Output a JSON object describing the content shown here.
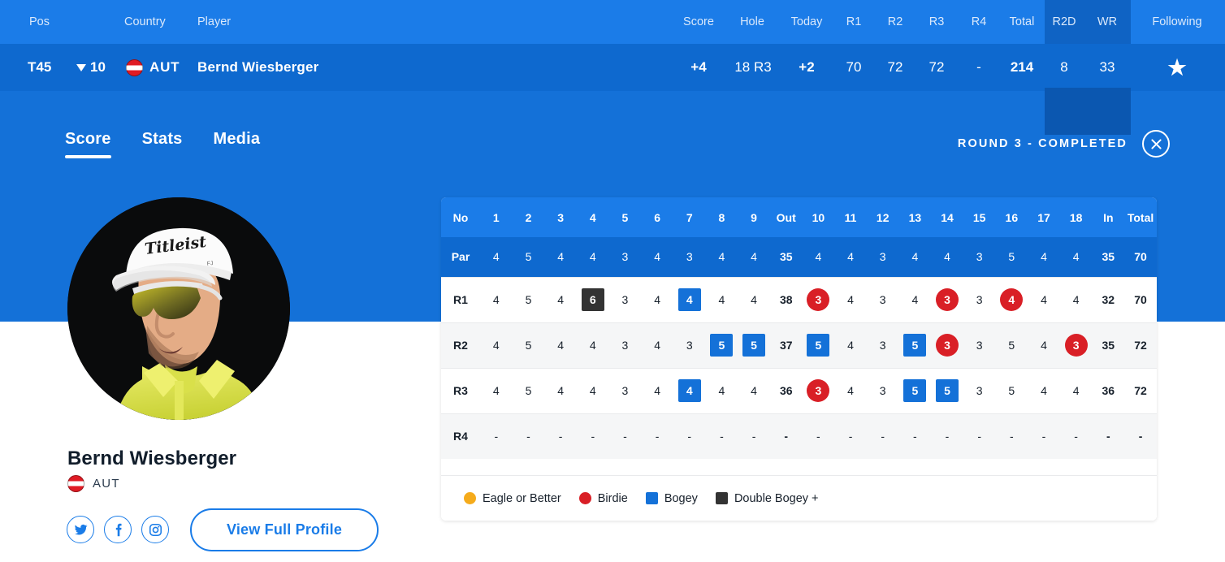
{
  "leaderboard": {
    "columns": {
      "pos": "Pos",
      "country": "Country",
      "player": "Player",
      "score": "Score",
      "hole": "Hole",
      "today": "Today",
      "r1": "R1",
      "r2": "R2",
      "r3": "R3",
      "r4": "R4",
      "total": "Total",
      "r2d": "R2D",
      "wr": "WR",
      "following": "Following"
    },
    "row": {
      "pos": "T45",
      "movement": "10",
      "movement_direction": "down",
      "country_code": "AUT",
      "player": "Bernd Wiesberger",
      "score": "+4",
      "hole": "18 R3",
      "today": "+2",
      "r1": "70",
      "r2": "72",
      "r3": "72",
      "r4": "-",
      "total": "214",
      "r2d": "8",
      "wr": "33",
      "following_icon": "star-icon"
    }
  },
  "tabs": [
    {
      "label": "Score",
      "active": true
    },
    {
      "label": "Stats",
      "active": false
    },
    {
      "label": "Media",
      "active": false
    }
  ],
  "round_status": {
    "text": "ROUND 3 - COMPLETED",
    "close_icon": "close-icon"
  },
  "profile": {
    "name": "Bernd Wiesberger",
    "country_code": "AUT",
    "social": [
      {
        "name": "twitter-icon",
        "label": "Twitter"
      },
      {
        "name": "facebook-icon",
        "label": "Facebook"
      },
      {
        "name": "instagram-icon",
        "label": "Instagram"
      }
    ],
    "view_profile_label": "View Full Profile"
  },
  "colors": {
    "brand_blue": "#1471d8",
    "header_blue": "#1b7ce8",
    "row_blue": "#0e69cf",
    "band_dark": "#0f63c4",
    "birdie_red": "#d91f26",
    "eagle_yellow": "#f5ab1b",
    "bogey_blue": "#1471d8",
    "double_dark": "#333333"
  },
  "scorecard": {
    "headers": [
      "No",
      "1",
      "2",
      "3",
      "4",
      "5",
      "6",
      "7",
      "8",
      "9",
      "Out",
      "10",
      "11",
      "12",
      "13",
      "14",
      "15",
      "16",
      "17",
      "18",
      "In",
      "Total"
    ],
    "rows": [
      {
        "label": "Par",
        "kind": "par",
        "cells": [
          "4",
          "5",
          "4",
          "4",
          "3",
          "4",
          "3",
          "4",
          "4",
          "35",
          "4",
          "4",
          "3",
          "4",
          "4",
          "3",
          "5",
          "4",
          "4",
          "35",
          "70"
        ],
        "marks": [
          "",
          "",
          "",
          "",
          "",
          "",
          "",
          "",
          "",
          "",
          "",
          "",
          "",
          "",
          "",
          "",
          "",
          "",
          "",
          "",
          ""
        ]
      },
      {
        "label": "R1",
        "kind": "round",
        "cells": [
          "4",
          "5",
          "4",
          "6",
          "3",
          "4",
          "4",
          "4",
          "4",
          "38",
          "3",
          "4",
          "3",
          "4",
          "3",
          "3",
          "4",
          "4",
          "4",
          "32",
          "70"
        ],
        "marks": [
          "",
          "",
          "",
          "double",
          "",
          "",
          "bogey",
          "",
          "",
          "",
          "birdie",
          "",
          "",
          "",
          "birdie",
          "",
          "birdie",
          "",
          "",
          "",
          ""
        ]
      },
      {
        "label": "R2",
        "kind": "round",
        "cells": [
          "4",
          "5",
          "4",
          "4",
          "3",
          "4",
          "3",
          "5",
          "5",
          "37",
          "5",
          "4",
          "3",
          "5",
          "3",
          "3",
          "5",
          "4",
          "3",
          "35",
          "72"
        ],
        "marks": [
          "",
          "",
          "",
          "",
          "",
          "",
          "",
          "bogey",
          "bogey",
          "",
          "bogey",
          "",
          "",
          "bogey",
          "birdie",
          "",
          "",
          "",
          "birdie",
          "",
          ""
        ]
      },
      {
        "label": "R3",
        "kind": "round",
        "cells": [
          "4",
          "5",
          "4",
          "4",
          "3",
          "4",
          "4",
          "4",
          "4",
          "36",
          "3",
          "4",
          "3",
          "5",
          "5",
          "3",
          "5",
          "4",
          "4",
          "36",
          "72"
        ],
        "marks": [
          "",
          "",
          "",
          "",
          "",
          "",
          "bogey",
          "",
          "",
          "",
          "birdie",
          "",
          "",
          "bogey",
          "bogey",
          "",
          "",
          "",
          "",
          "",
          ""
        ]
      },
      {
        "label": "R4",
        "kind": "round",
        "cells": [
          "-",
          "-",
          "-",
          "-",
          "-",
          "-",
          "-",
          "-",
          "-",
          "-",
          "-",
          "-",
          "-",
          "-",
          "-",
          "-",
          "-",
          "-",
          "-",
          "-",
          "-"
        ],
        "marks": [
          "",
          "",
          "",
          "",
          "",
          "",
          "",
          "",
          "",
          "",
          "",
          "",
          "",
          "",
          "",
          "",
          "",
          "",
          "",
          "",
          ""
        ]
      }
    ],
    "legend": [
      {
        "label": "Eagle or Better",
        "mark": "eagle"
      },
      {
        "label": "Birdie",
        "mark": "birdie"
      },
      {
        "label": "Bogey",
        "mark": "bogey"
      },
      {
        "label": "Double Bogey +",
        "mark": "double"
      }
    ]
  }
}
